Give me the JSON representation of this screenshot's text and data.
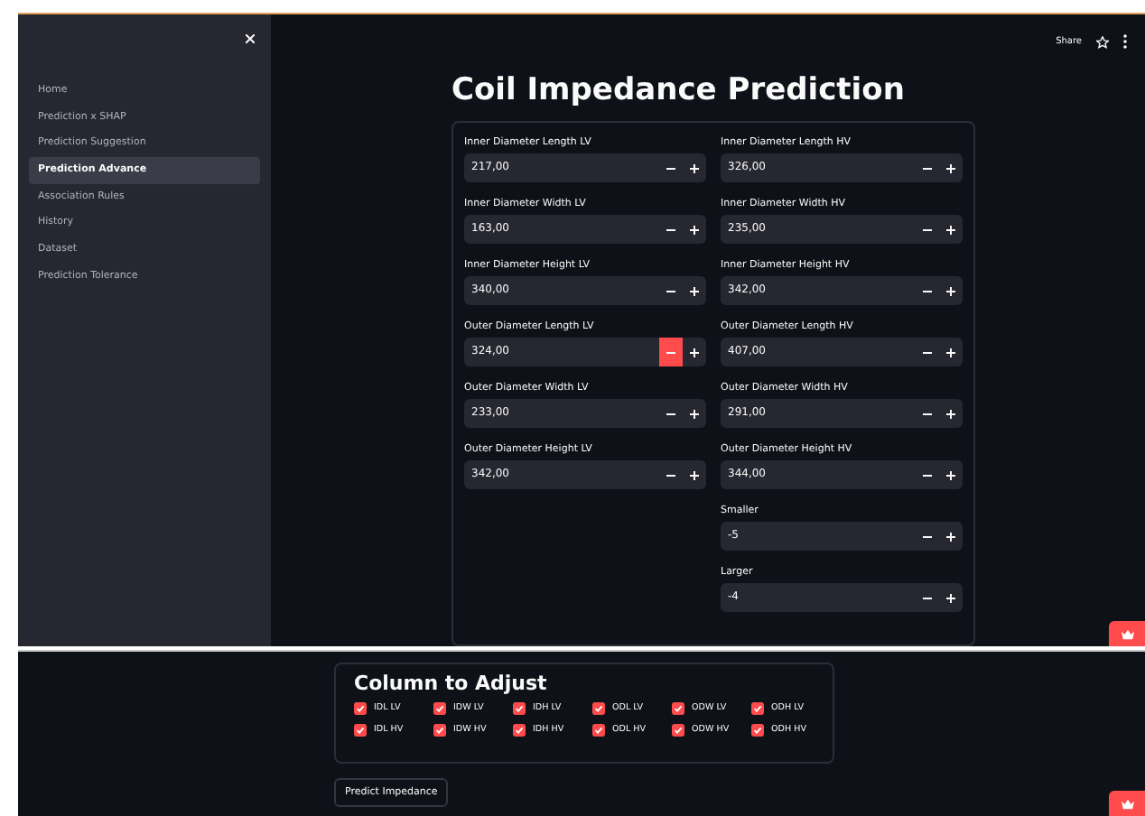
{
  "header": {
    "share": "Share"
  },
  "sidebar": {
    "items": [
      {
        "label": "Home",
        "selected": false
      },
      {
        "label": "Prediction x SHAP",
        "selected": false
      },
      {
        "label": "Prediction Suggestion",
        "selected": false
      },
      {
        "label": "Prediction Advance",
        "selected": true
      },
      {
        "label": "Association Rules",
        "selected": false
      },
      {
        "label": "History",
        "selected": false
      },
      {
        "label": "Dataset",
        "selected": false
      },
      {
        "label": "Prediction Tolerance",
        "selected": false
      }
    ]
  },
  "title": "Coil Impedance Prediction",
  "left_fields": [
    {
      "label": "Inner Diameter Length LV",
      "value": "217,00",
      "minus_active": false
    },
    {
      "label": "Inner Diameter Width LV",
      "value": "163,00",
      "minus_active": false
    },
    {
      "label": "Inner Diameter Height LV",
      "value": "340,00",
      "minus_active": false
    },
    {
      "label": "Outer Diameter Length LV",
      "value": "324,00",
      "minus_active": true
    },
    {
      "label": "Outer Diameter Width LV",
      "value": "233,00",
      "minus_active": false
    },
    {
      "label": "Outer Diameter Height LV",
      "value": "342,00",
      "minus_active": false
    }
  ],
  "right_fields": [
    {
      "label": "Inner Diameter Length HV",
      "value": "326,00",
      "minus_active": false
    },
    {
      "label": "Inner Diameter Width HV",
      "value": "235,00",
      "minus_active": false
    },
    {
      "label": "Inner Diameter Height HV",
      "value": "342,00",
      "minus_active": false
    },
    {
      "label": "Outer Diameter Length HV",
      "value": "407,00",
      "minus_active": false
    },
    {
      "label": "Outer Diameter Width HV",
      "value": "291,00",
      "minus_active": false
    },
    {
      "label": "Outer Diameter Height HV",
      "value": "344,00",
      "minus_active": false
    },
    {
      "label": "Smaller",
      "value": "-5",
      "minus_active": false
    },
    {
      "label": "Larger",
      "value": "-4",
      "minus_active": false
    }
  ],
  "adjust": {
    "title": "Column to Adjust",
    "columns": [
      {
        "label": "IDL LV",
        "checked": true
      },
      {
        "label": "IDW LV",
        "checked": true
      },
      {
        "label": "IDH LV",
        "checked": true
      },
      {
        "label": "ODL LV",
        "checked": true
      },
      {
        "label": "ODW LV",
        "checked": true
      },
      {
        "label": "ODH LV",
        "checked": true
      },
      {
        "label": "IDL HV",
        "checked": true
      },
      {
        "label": "IDW HV",
        "checked": true
      },
      {
        "label": "IDH HV",
        "checked": true
      },
      {
        "label": "ODL HV",
        "checked": true
      },
      {
        "label": "ODW HV",
        "checked": true
      },
      {
        "label": "ODH HV",
        "checked": true
      }
    ]
  },
  "predict_button": "Predict Impedance"
}
